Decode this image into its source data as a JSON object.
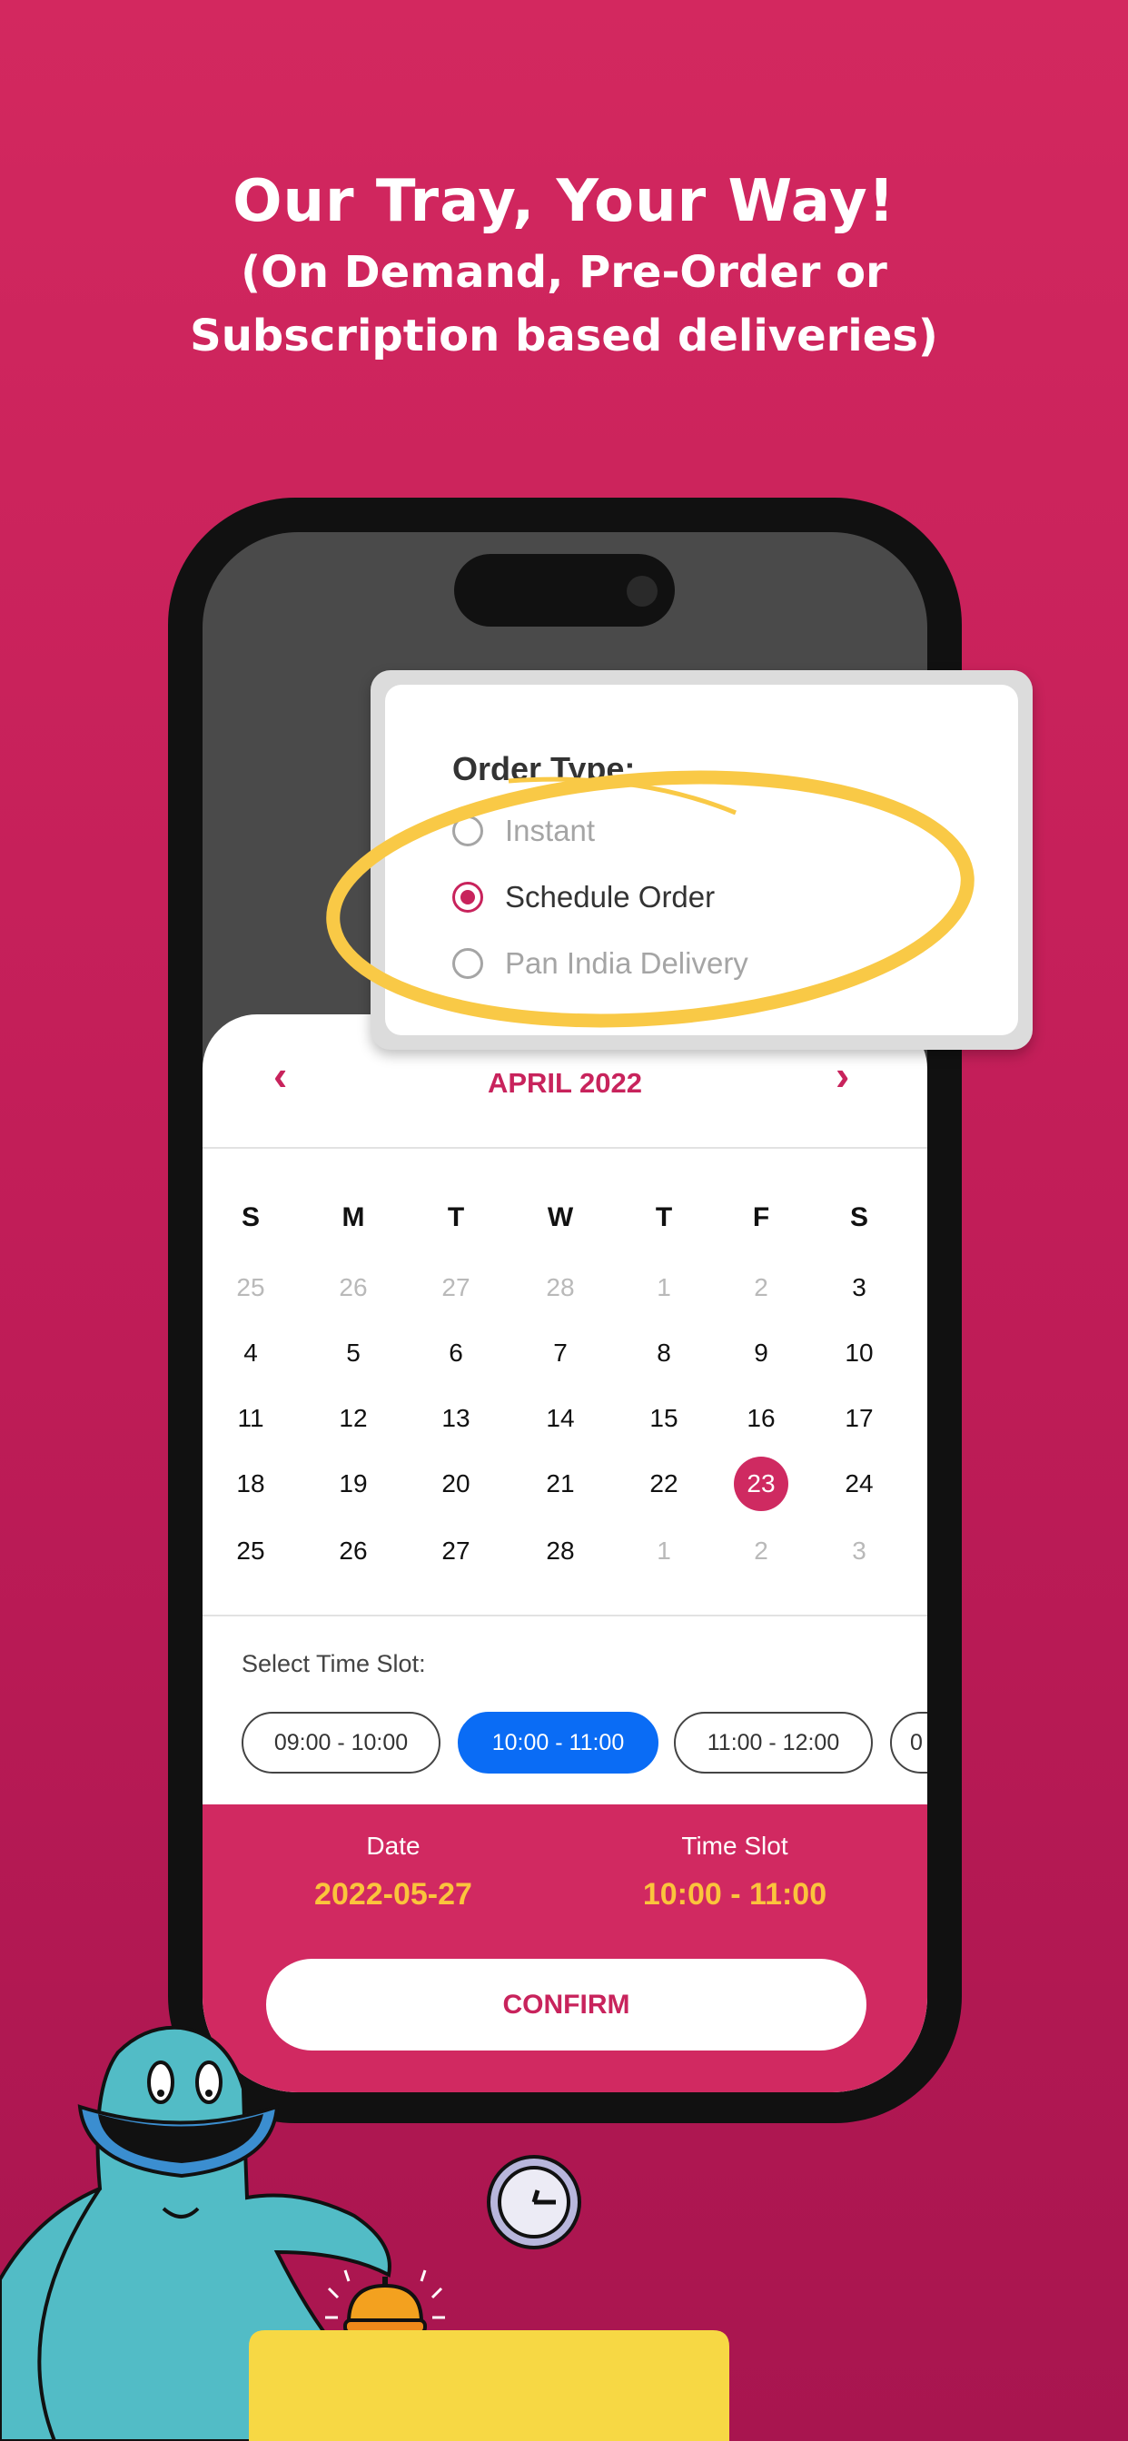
{
  "headline": {
    "title": "Our Tray, Your Way!",
    "line2": "(On Demand, Pre-Order or",
    "line3": "Subscription based deliveries)"
  },
  "order_type": {
    "title": "Order Type:",
    "options": [
      {
        "label": "Instant",
        "selected": false
      },
      {
        "label": "Schedule Order",
        "selected": true
      },
      {
        "label": "Pan India Delivery",
        "selected": false
      }
    ]
  },
  "calendar": {
    "month": "APRIL 2022",
    "prev_icon": "chevron-left-icon",
    "next_icon": "chevron-right-icon",
    "weekdays": [
      "S",
      "M",
      "T",
      "W",
      "T",
      "F",
      "S"
    ],
    "weeks": [
      [
        {
          "d": "25",
          "m": true
        },
        {
          "d": "26",
          "m": true
        },
        {
          "d": "27",
          "m": true
        },
        {
          "d": "28",
          "m": true
        },
        {
          "d": "1",
          "m": true
        },
        {
          "d": "2",
          "m": true
        },
        {
          "d": "3"
        }
      ],
      [
        {
          "d": "4"
        },
        {
          "d": "5"
        },
        {
          "d": "6"
        },
        {
          "d": "7"
        },
        {
          "d": "8"
        },
        {
          "d": "9"
        },
        {
          "d": "10"
        }
      ],
      [
        {
          "d": "11"
        },
        {
          "d": "12"
        },
        {
          "d": "13"
        },
        {
          "d": "14"
        },
        {
          "d": "15"
        },
        {
          "d": "16"
        },
        {
          "d": "17"
        }
      ],
      [
        {
          "d": "18"
        },
        {
          "d": "19"
        },
        {
          "d": "20"
        },
        {
          "d": "21"
        },
        {
          "d": "22"
        },
        {
          "d": "23",
          "s": true
        },
        {
          "d": "24"
        }
      ],
      [
        {
          "d": "25"
        },
        {
          "d": "26"
        },
        {
          "d": "27"
        },
        {
          "d": "28"
        },
        {
          "d": "1",
          "m": true
        },
        {
          "d": "2",
          "m": true
        },
        {
          "d": "3",
          "m": true
        }
      ]
    ]
  },
  "time_slots": {
    "label": "Select Time Slot:",
    "slots": [
      {
        "label": "09:00 - 10:00"
      },
      {
        "label": "10:00 - 11:00",
        "selected": true
      },
      {
        "label": "11:00 - 12:00"
      },
      {
        "label": "0"
      }
    ]
  },
  "summary": {
    "date_label": "Date",
    "date_value": "2022-05-27",
    "slot_label": "Time Slot",
    "slot_value": "10:00 - 11:00",
    "confirm": "CONFIRM"
  },
  "colors": {
    "brand": "#d12961",
    "accent": "#fbc43c",
    "selected_slot": "#0a6cf5",
    "highlight": "#f9c946"
  }
}
